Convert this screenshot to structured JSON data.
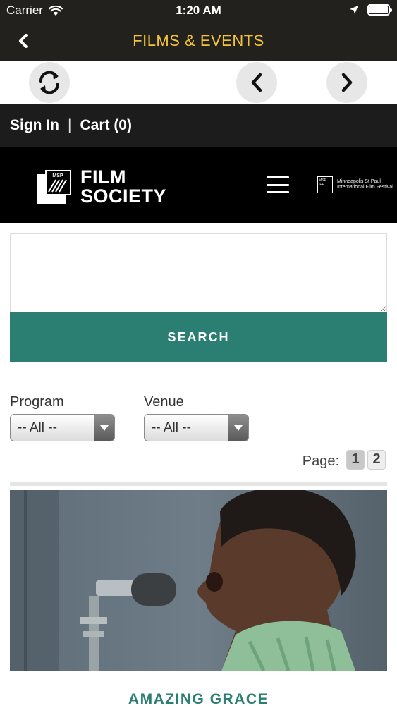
{
  "status_bar": {
    "carrier": "Carrier",
    "time": "1:20 AM",
    "battery_percent": 100
  },
  "nav_bar": {
    "back_icon": "chevron-left-icon",
    "title": "FILMS & EVENTS",
    "title_color": "#f3c43b",
    "background": "#23211d"
  },
  "toolbar": {
    "refresh_icon": "refresh-icon",
    "prev_icon": "chevron-left-icon",
    "next_icon": "chevron-right-icon"
  },
  "account_bar": {
    "sign_in": "Sign In",
    "separator": "|",
    "cart": "Cart (0)"
  },
  "site_header": {
    "logo_badge": "MSP",
    "logo_line1": "FILM",
    "logo_line2": "SOCIETY",
    "menu_icon": "hamburger-menu-icon",
    "festival_badge_line1": "MSP",
    "festival_badge_line2": "IFF",
    "festival_name_line1": "Minneapolis St Paul",
    "festival_name_line2": "International Film Festival"
  },
  "search": {
    "value": "",
    "placeholder": "",
    "button_label": "SEARCH",
    "button_color": "#2a7f72"
  },
  "filters": {
    "program_label": "Program",
    "program_selected": "-- All --",
    "venue_label": "Venue",
    "venue_selected": "-- All --"
  },
  "pagination": {
    "label": "Page:",
    "pages": [
      "1",
      "2"
    ],
    "current": "1"
  },
  "film": {
    "title": "AMAZING GRACE",
    "title_color": "#2a7f72"
  }
}
